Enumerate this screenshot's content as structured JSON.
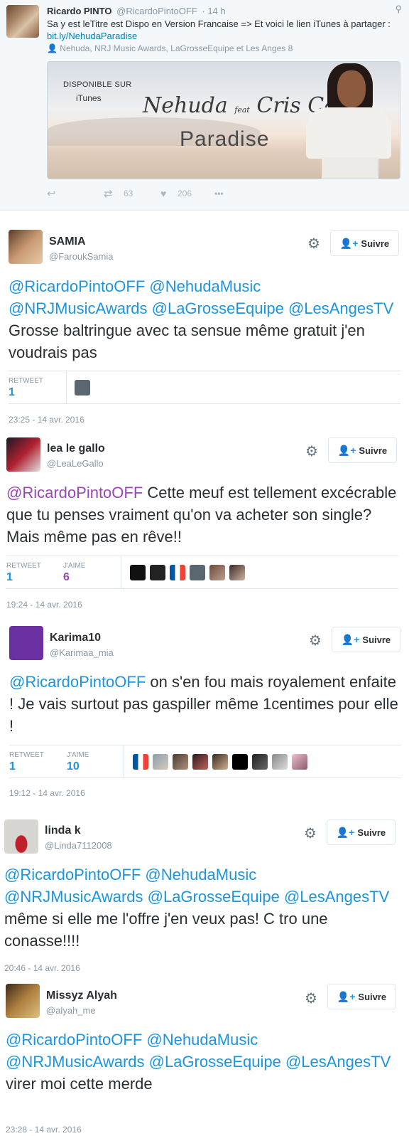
{
  "original": {
    "name": "Ricardo PINTO",
    "handle": "@RicardoPintoOFF",
    "time": "· 14 h",
    "text": "Sa y est leTitre est Dispo en Version Francaise => Et voici le lien iTunes à partager :",
    "link": "bit.ly/NehudaParadise",
    "mentions": "Nehuda, NRJ Music Awards, LaGrosseEquipe et Les Anges 8",
    "card": {
      "disponible": "DISPONIBLE SUR",
      "itunes": " iTunes",
      "artist": "Nehuda",
      "feat": "feat",
      "artist2": "Cris Cab",
      "song": "Paradise"
    },
    "retweets": "63",
    "likes": "206",
    "more": "•••"
  },
  "follow_label": "Suivre",
  "labels": {
    "retweet": "RETWEET",
    "like": "J'AIME"
  },
  "replies": [
    {
      "name": "SAMIA",
      "handle": "@FaroukSamia",
      "mentions": "@RicardoPintoOFF @NehudaMusic @NRJMusicAwards @LaGrosseEquipe @LesAngesTV",
      "body": " Grosse baltringue avec ta sensue même gratuit j'en voudrais pas",
      "retweets": "1",
      "date": "23:25 - 14 avr. 2016"
    },
    {
      "name": "lea le gallo",
      "handle": "@LeaLeGallo",
      "mentions": "@RicardoPintoOFF",
      "body": " Cette meuf est tellement excécrable que tu penses vraiment qu'on va acheter son single? Mais même pas en rêve!!",
      "retweets": "1",
      "likes": "6",
      "date": "19:24 - 14 avr. 2016"
    },
    {
      "name": "Karima10",
      "handle": "@Karimaa_mia",
      "mentions": "@RicardoPintoOFF",
      "body": " on s'en fou mais royalement enfaite ! Je vais surtout pas gaspiller même 1centimes pour elle !",
      "retweets": "1",
      "likes": "10",
      "date": "19:12 - 14 avr. 2016"
    },
    {
      "name": "linda k",
      "handle": "@Linda7112008",
      "mentions": "@RicardoPintoOFF @NehudaMusic @NRJMusicAwards @LaGrosseEquipe @LesAngesTV",
      "body": " même si elle me l'offre j'en veux pas! C tro une conasse!!!!",
      "date": "20:46 - 14 avr. 2016"
    },
    {
      "name": "Missyz Alyah",
      "handle": "@alyah_me",
      "mentions": "@RicardoPintoOFF @NehudaMusic @NRJMusicAwards @LaGrosseEquipe @LesAngesTV",
      "body": " virer moi cette merde",
      "date": "23:28 - 14 avr. 2016"
    }
  ],
  "colors": {
    "link": "#1b95e0",
    "like": "#9b46b7",
    "muted": "#8899a6",
    "border": "#e1e8ed"
  }
}
